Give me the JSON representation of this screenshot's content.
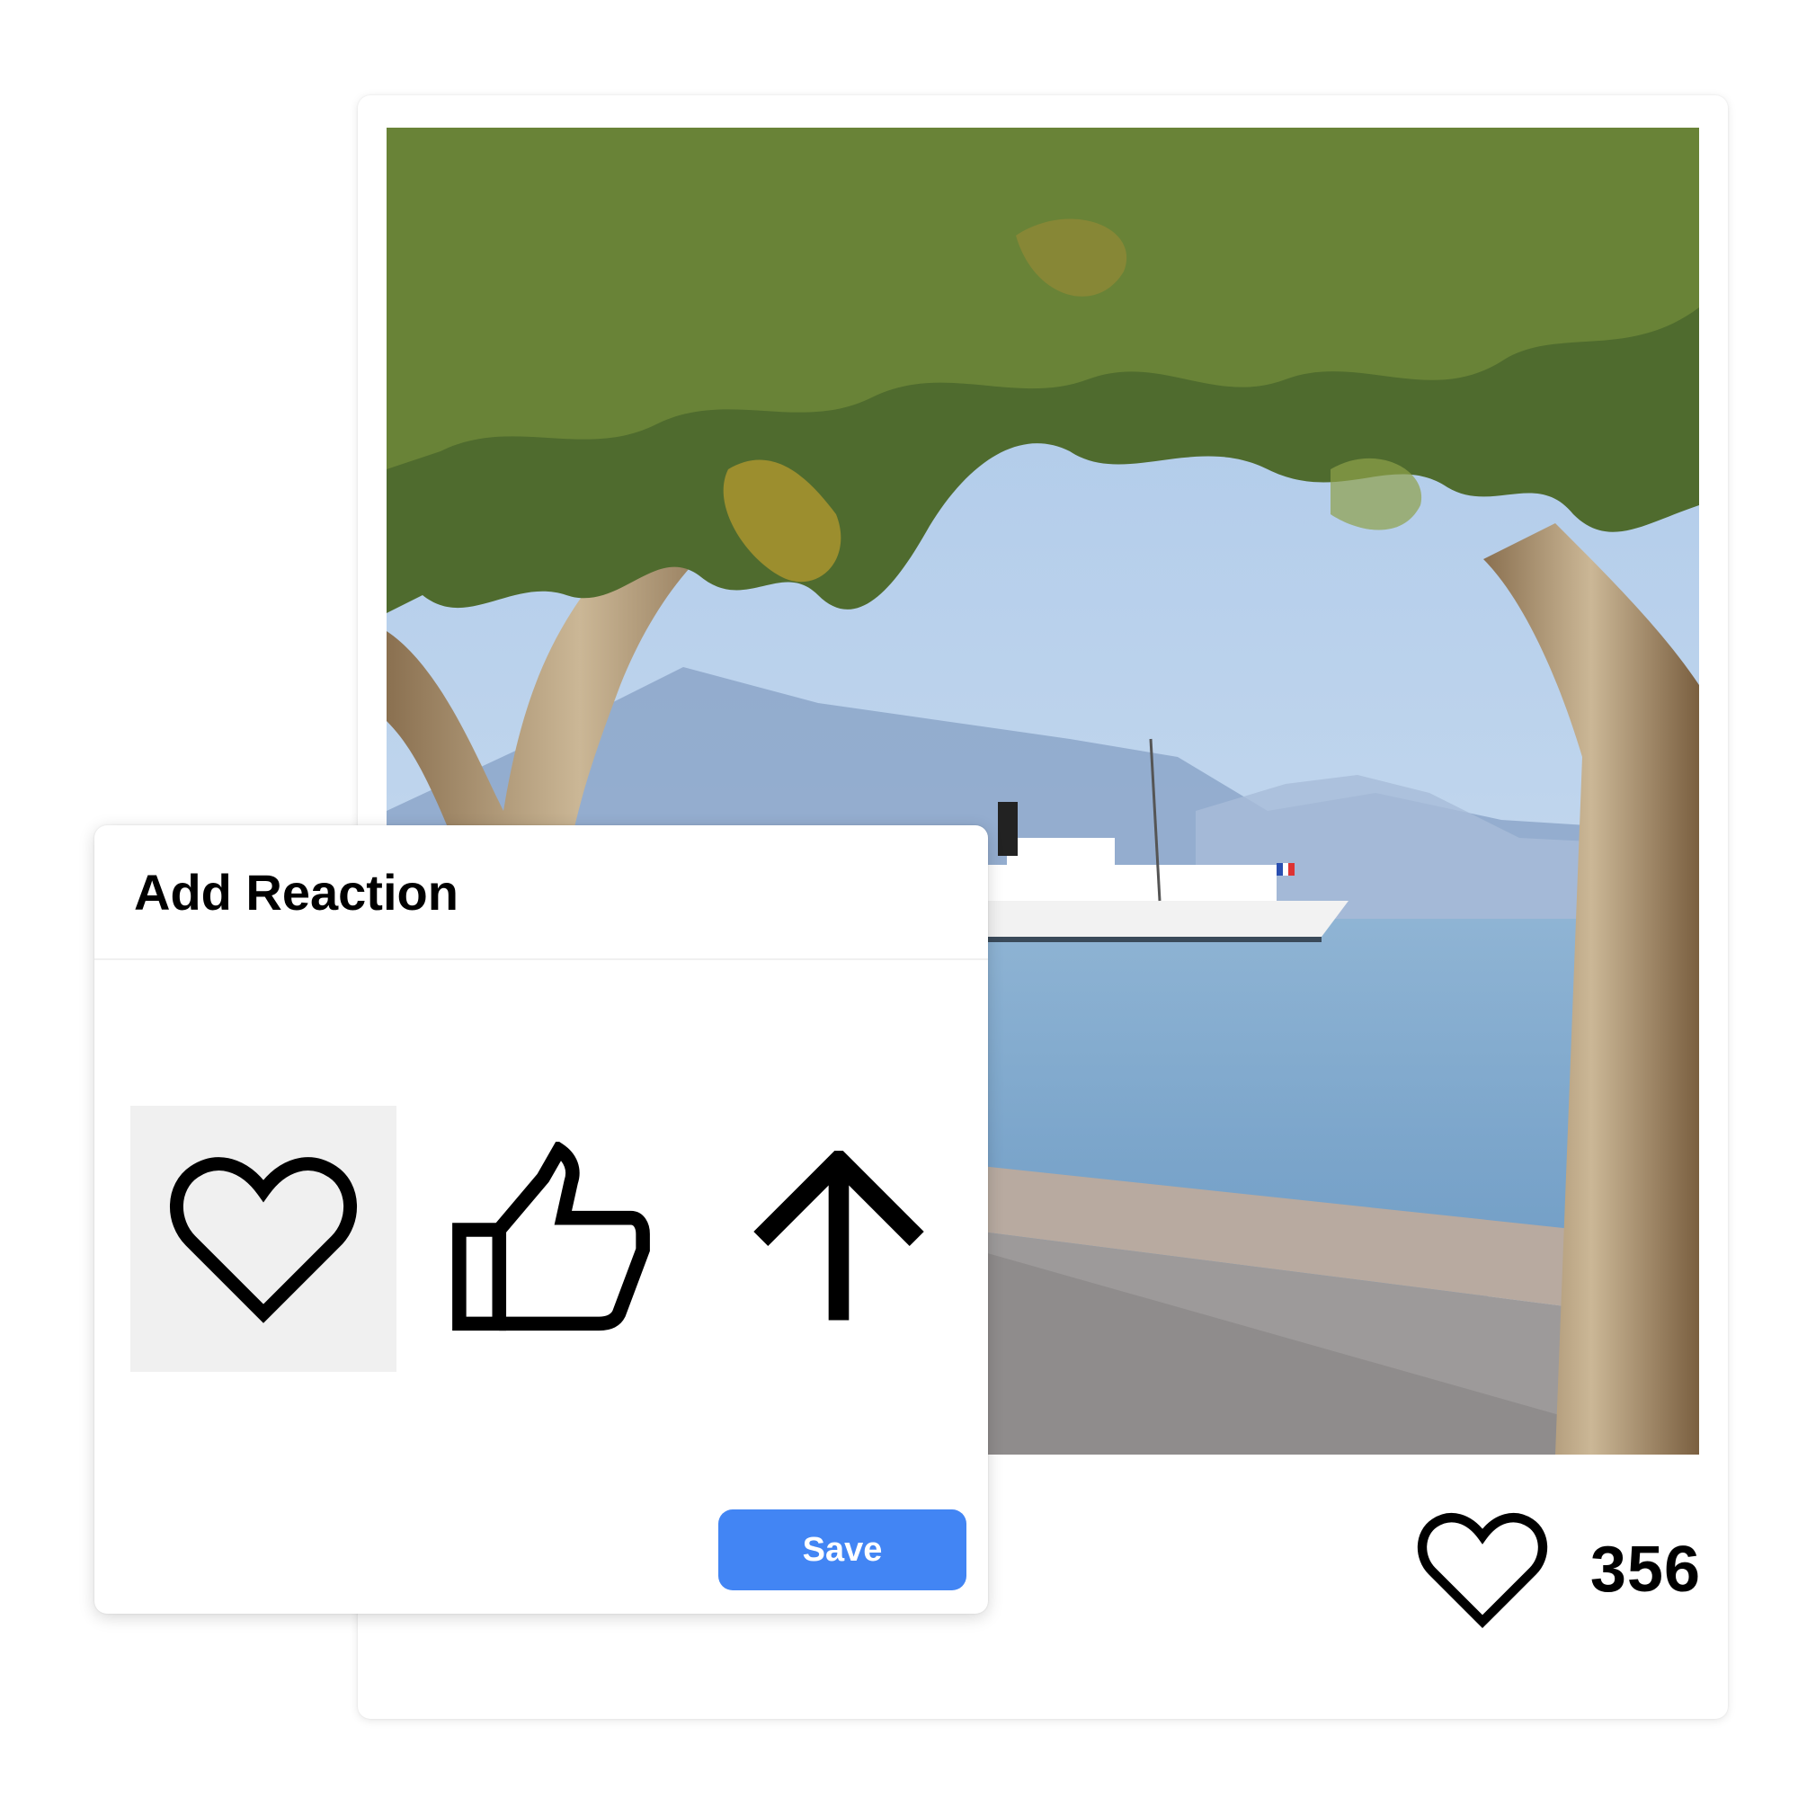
{
  "post": {
    "photo_description_icon": "lakeside-photo",
    "likes_count": "356",
    "like_icon": "heart-outline-icon"
  },
  "dialog": {
    "title": "Add Reaction",
    "options": [
      {
        "icon": "heart-icon",
        "selected": true
      },
      {
        "icon": "thumbs-up-icon",
        "selected": false
      },
      {
        "icon": "arrow-up-icon",
        "selected": false
      }
    ],
    "save_label": "Save"
  },
  "colors": {
    "accent": "#4285f4",
    "selected_bg": "#f0f0f0",
    "icon_stroke": "#000000"
  }
}
